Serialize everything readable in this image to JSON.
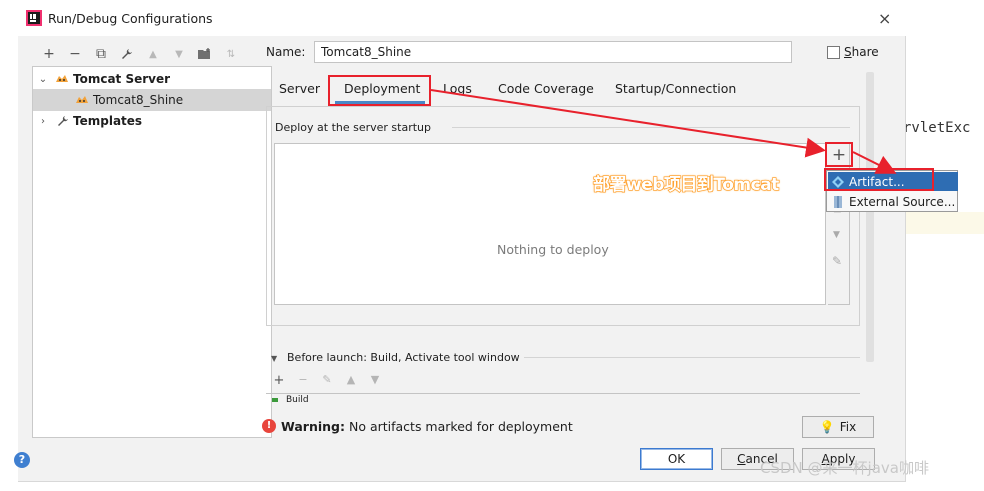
{
  "background": {
    "editor_fragment": "rvletExc"
  },
  "window": {
    "title": "Run/Debug Configurations",
    "close_glyph": "×"
  },
  "left_toolbar": {
    "icons": [
      "add-icon",
      "remove-icon",
      "copy-icon",
      "wrench-icon",
      "move-up-icon",
      "move-down-icon",
      "folder-icon",
      "sort-icon"
    ],
    "glyphs": [
      "+",
      "−",
      "⧉",
      "🔧",
      "▲",
      "▼",
      "▮",
      "⇅"
    ]
  },
  "tree": {
    "items": [
      {
        "label": "Tomcat Server",
        "level": 0,
        "expanded": true,
        "bold": true
      },
      {
        "label": "Tomcat8_Shine",
        "level": 1,
        "selected": true
      },
      {
        "label": "Templates",
        "level": 0,
        "expanded": false,
        "bold": true
      }
    ]
  },
  "name": {
    "label": "Name:",
    "value": "Tomcat8_Shine"
  },
  "share": {
    "label_first": "S",
    "label_rest": "hare",
    "checked": false
  },
  "tabs": [
    {
      "label": "Server",
      "active": false
    },
    {
      "label": "Deployment",
      "active": true
    },
    {
      "label": "Logs",
      "active": false
    },
    {
      "label": "Code Coverage",
      "active": false
    },
    {
      "label": "Startup/Connection",
      "active": false
    }
  ],
  "deployment": {
    "section_label": "Deploy at the server startup",
    "empty_text": "Nothing to deploy",
    "add_glyph": "+",
    "pencil_glyph": "✎"
  },
  "popup": {
    "items": [
      {
        "label": "Artifact...",
        "selected": true
      },
      {
        "label": "External Source...",
        "selected": false
      }
    ]
  },
  "annotation": {
    "text": "部署web项目到Tomcat",
    "color": "#ff9a1f"
  },
  "before_launch": {
    "label": "Before launch: Build, Activate tool window",
    "partial_item": "Build"
  },
  "warning": {
    "label": "Warning:",
    "message": "No artifacts marked for deployment"
  },
  "buttons": {
    "fix": "Fix",
    "ok": "OK",
    "cancel_first": "C",
    "cancel_rest": "ancel",
    "apply_first": "A",
    "apply_rest": "pply"
  },
  "watermark": "CSDN @来一杯java咖啡",
  "colors": {
    "accent": "#4a88c7",
    "highlight_red": "#e8212c",
    "selection_blue": "#2e6db3",
    "warning_red": "#e8453c"
  }
}
